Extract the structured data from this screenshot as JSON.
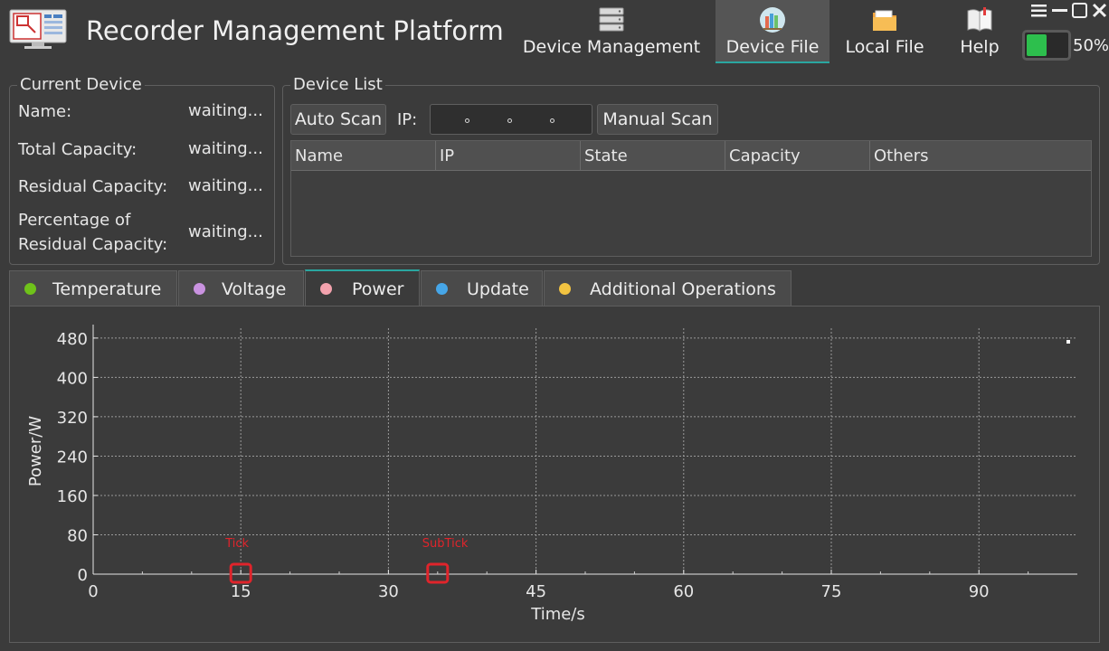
{
  "header": {
    "title": "Recorder Management Platform",
    "nav": [
      {
        "label": "Device Management",
        "icon": "server-icon",
        "active": false
      },
      {
        "label": "Device File",
        "icon": "books-icon",
        "active": true
      },
      {
        "label": "Local File",
        "icon": "folder-icon",
        "active": false
      },
      {
        "label": "Help",
        "icon": "book-icon",
        "active": false
      }
    ],
    "window_controls": [
      "menu-icon",
      "minimize-icon",
      "maximize-icon",
      "close-icon"
    ],
    "battery": {
      "level": 0.5,
      "text": "50%",
      "color": "#2dbf4d"
    }
  },
  "current_device": {
    "title": "Current Device",
    "rows": [
      {
        "label": "Name:",
        "value": "waiting..."
      },
      {
        "label": "Total Capacity:",
        "value": "waiting..."
      },
      {
        "label": "Residual Capacity:",
        "value": "waiting..."
      },
      {
        "label": "Percentage of\nResidual Capacity:",
        "value": "waiting..."
      }
    ]
  },
  "device_list": {
    "title": "Device List",
    "auto_scan": "Auto Scan",
    "ip_label": "IP:",
    "manual_scan": "Manual Scan",
    "columns": [
      "Name",
      "IP",
      "State",
      "Capacity",
      "Others"
    ]
  },
  "tabs": [
    {
      "label": "Temperature",
      "color": "#6fc21a",
      "active": false
    },
    {
      "label": "Voltage",
      "color": "#c992e0",
      "active": false
    },
    {
      "label": "Power",
      "color": "#f3a2ad",
      "active": true
    },
    {
      "label": "Update",
      "color": "#46a6e8",
      "active": false
    },
    {
      "label": "Additional Operations",
      "color": "#f2c341",
      "active": false
    }
  ],
  "chart_data": {
    "type": "line",
    "xlabel": "Time/s",
    "ylabel": "Power/W",
    "xlim": [
      0,
      100
    ],
    "ylim": [
      0,
      500
    ],
    "xticks": [
      0,
      15,
      30,
      45,
      60,
      75,
      90
    ],
    "yticks": [
      0,
      80,
      160,
      240,
      320,
      400,
      480
    ],
    "grid": true,
    "series": [],
    "annotations": [
      {
        "text": "Tick",
        "x": 15,
        "y": 0
      },
      {
        "text": "SubTick",
        "x": 35,
        "y": 0
      }
    ],
    "annotation_color": "#e0242b"
  }
}
